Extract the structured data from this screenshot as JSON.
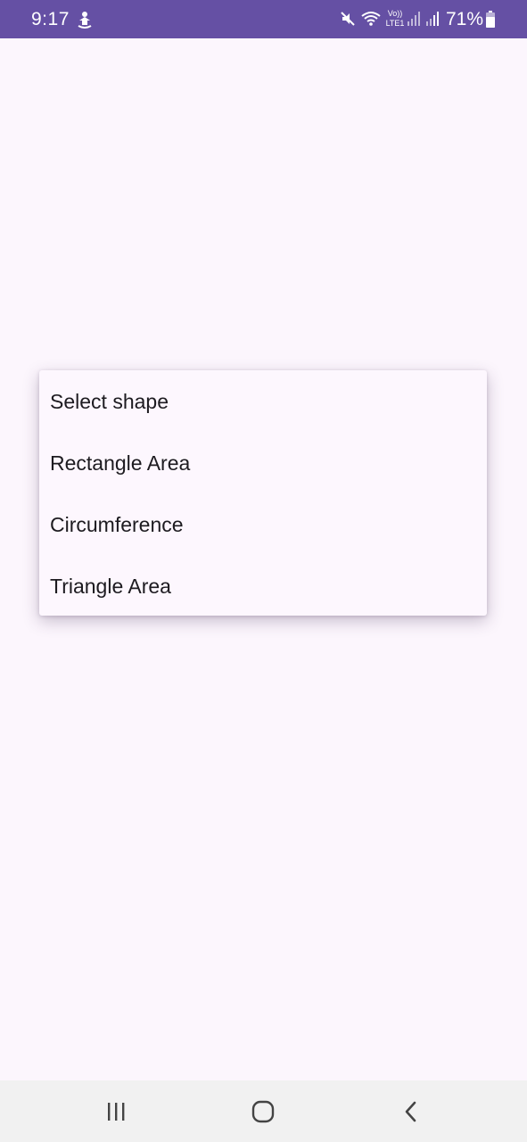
{
  "status_bar": {
    "time": "9:17",
    "network_label_top": "Vo))",
    "network_label_bottom": "LTE1",
    "battery_percent": "71%",
    "icons": [
      "notification-icon",
      "mute-icon",
      "wifi-icon",
      "signal-icon",
      "battery-icon"
    ],
    "background_color": "#6550a4"
  },
  "dropdown": {
    "items": [
      {
        "label": "Select shape"
      },
      {
        "label": "Rectangle Area"
      },
      {
        "label": "Circumference"
      },
      {
        "label": "Triangle Area"
      }
    ]
  },
  "nav_bar": {
    "icons": [
      "recent-apps-icon",
      "home-icon",
      "back-icon"
    ]
  },
  "colors": {
    "background": "#fcf6fd",
    "text": "#1d1b20"
  }
}
